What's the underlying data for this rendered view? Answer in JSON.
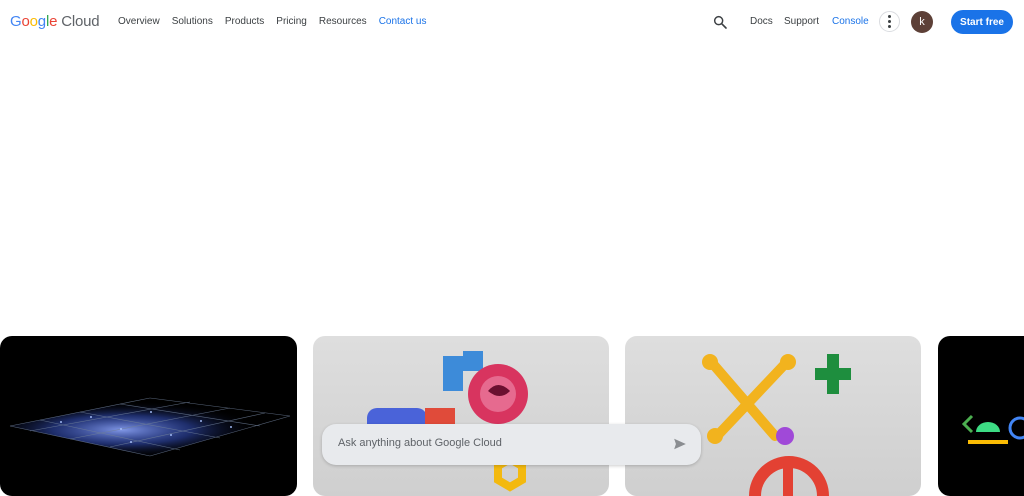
{
  "header": {
    "logo": {
      "g1": "G",
      "g2": "o",
      "g3": "o",
      "g4": "g",
      "g5": "l",
      "g6": "e",
      "cloud": "Cloud"
    },
    "nav": [
      "Overview",
      "Solutions",
      "Products",
      "Pricing",
      "Resources",
      "Contact us"
    ],
    "docs": "Docs",
    "support": "Support",
    "console": "Console",
    "avatar_initial": "k",
    "start_free": "Start free"
  },
  "ask": {
    "placeholder": "Ask anything about Google Cloud"
  },
  "colors": {
    "accent": "#1a73e8",
    "avatar": "#5d4037"
  }
}
